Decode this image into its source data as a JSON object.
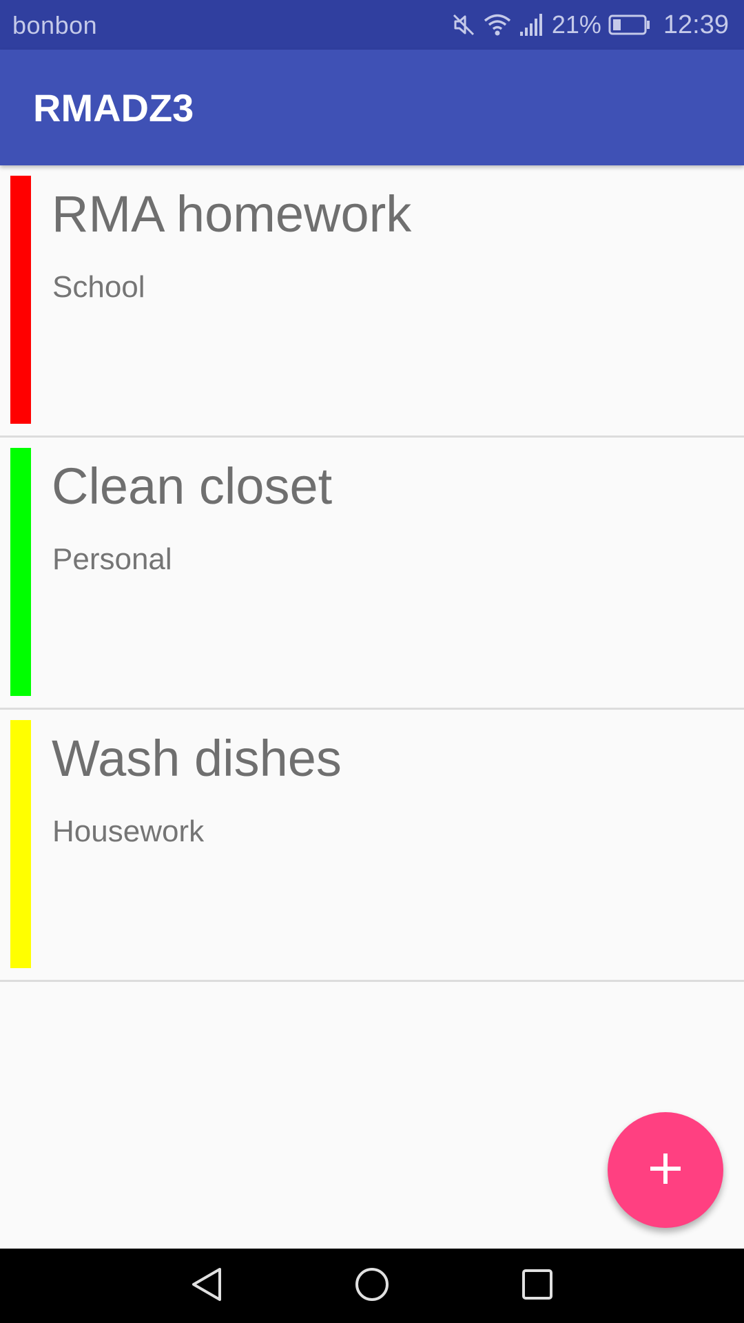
{
  "status_bar": {
    "carrier": "bonbon",
    "battery_percent": "21%",
    "time": "12:39",
    "icons": [
      "muted-icon",
      "wifi-icon",
      "signal-icon",
      "battery-icon"
    ]
  },
  "app_bar": {
    "title": "RMADZ3",
    "color": "#3f51b5"
  },
  "tasks": [
    {
      "title": "RMA homework",
      "category": "School",
      "color": "#ff0000"
    },
    {
      "title": "Clean closet",
      "category": "Personal",
      "color": "#00ff00"
    },
    {
      "title": "Wash dishes",
      "category": "Housework",
      "color": "#ffff00"
    }
  ],
  "fab": {
    "icon": "plus-icon",
    "color": "#ff4081"
  },
  "nav_bar": {
    "buttons": [
      "back-icon",
      "home-icon",
      "recents-icon"
    ]
  }
}
